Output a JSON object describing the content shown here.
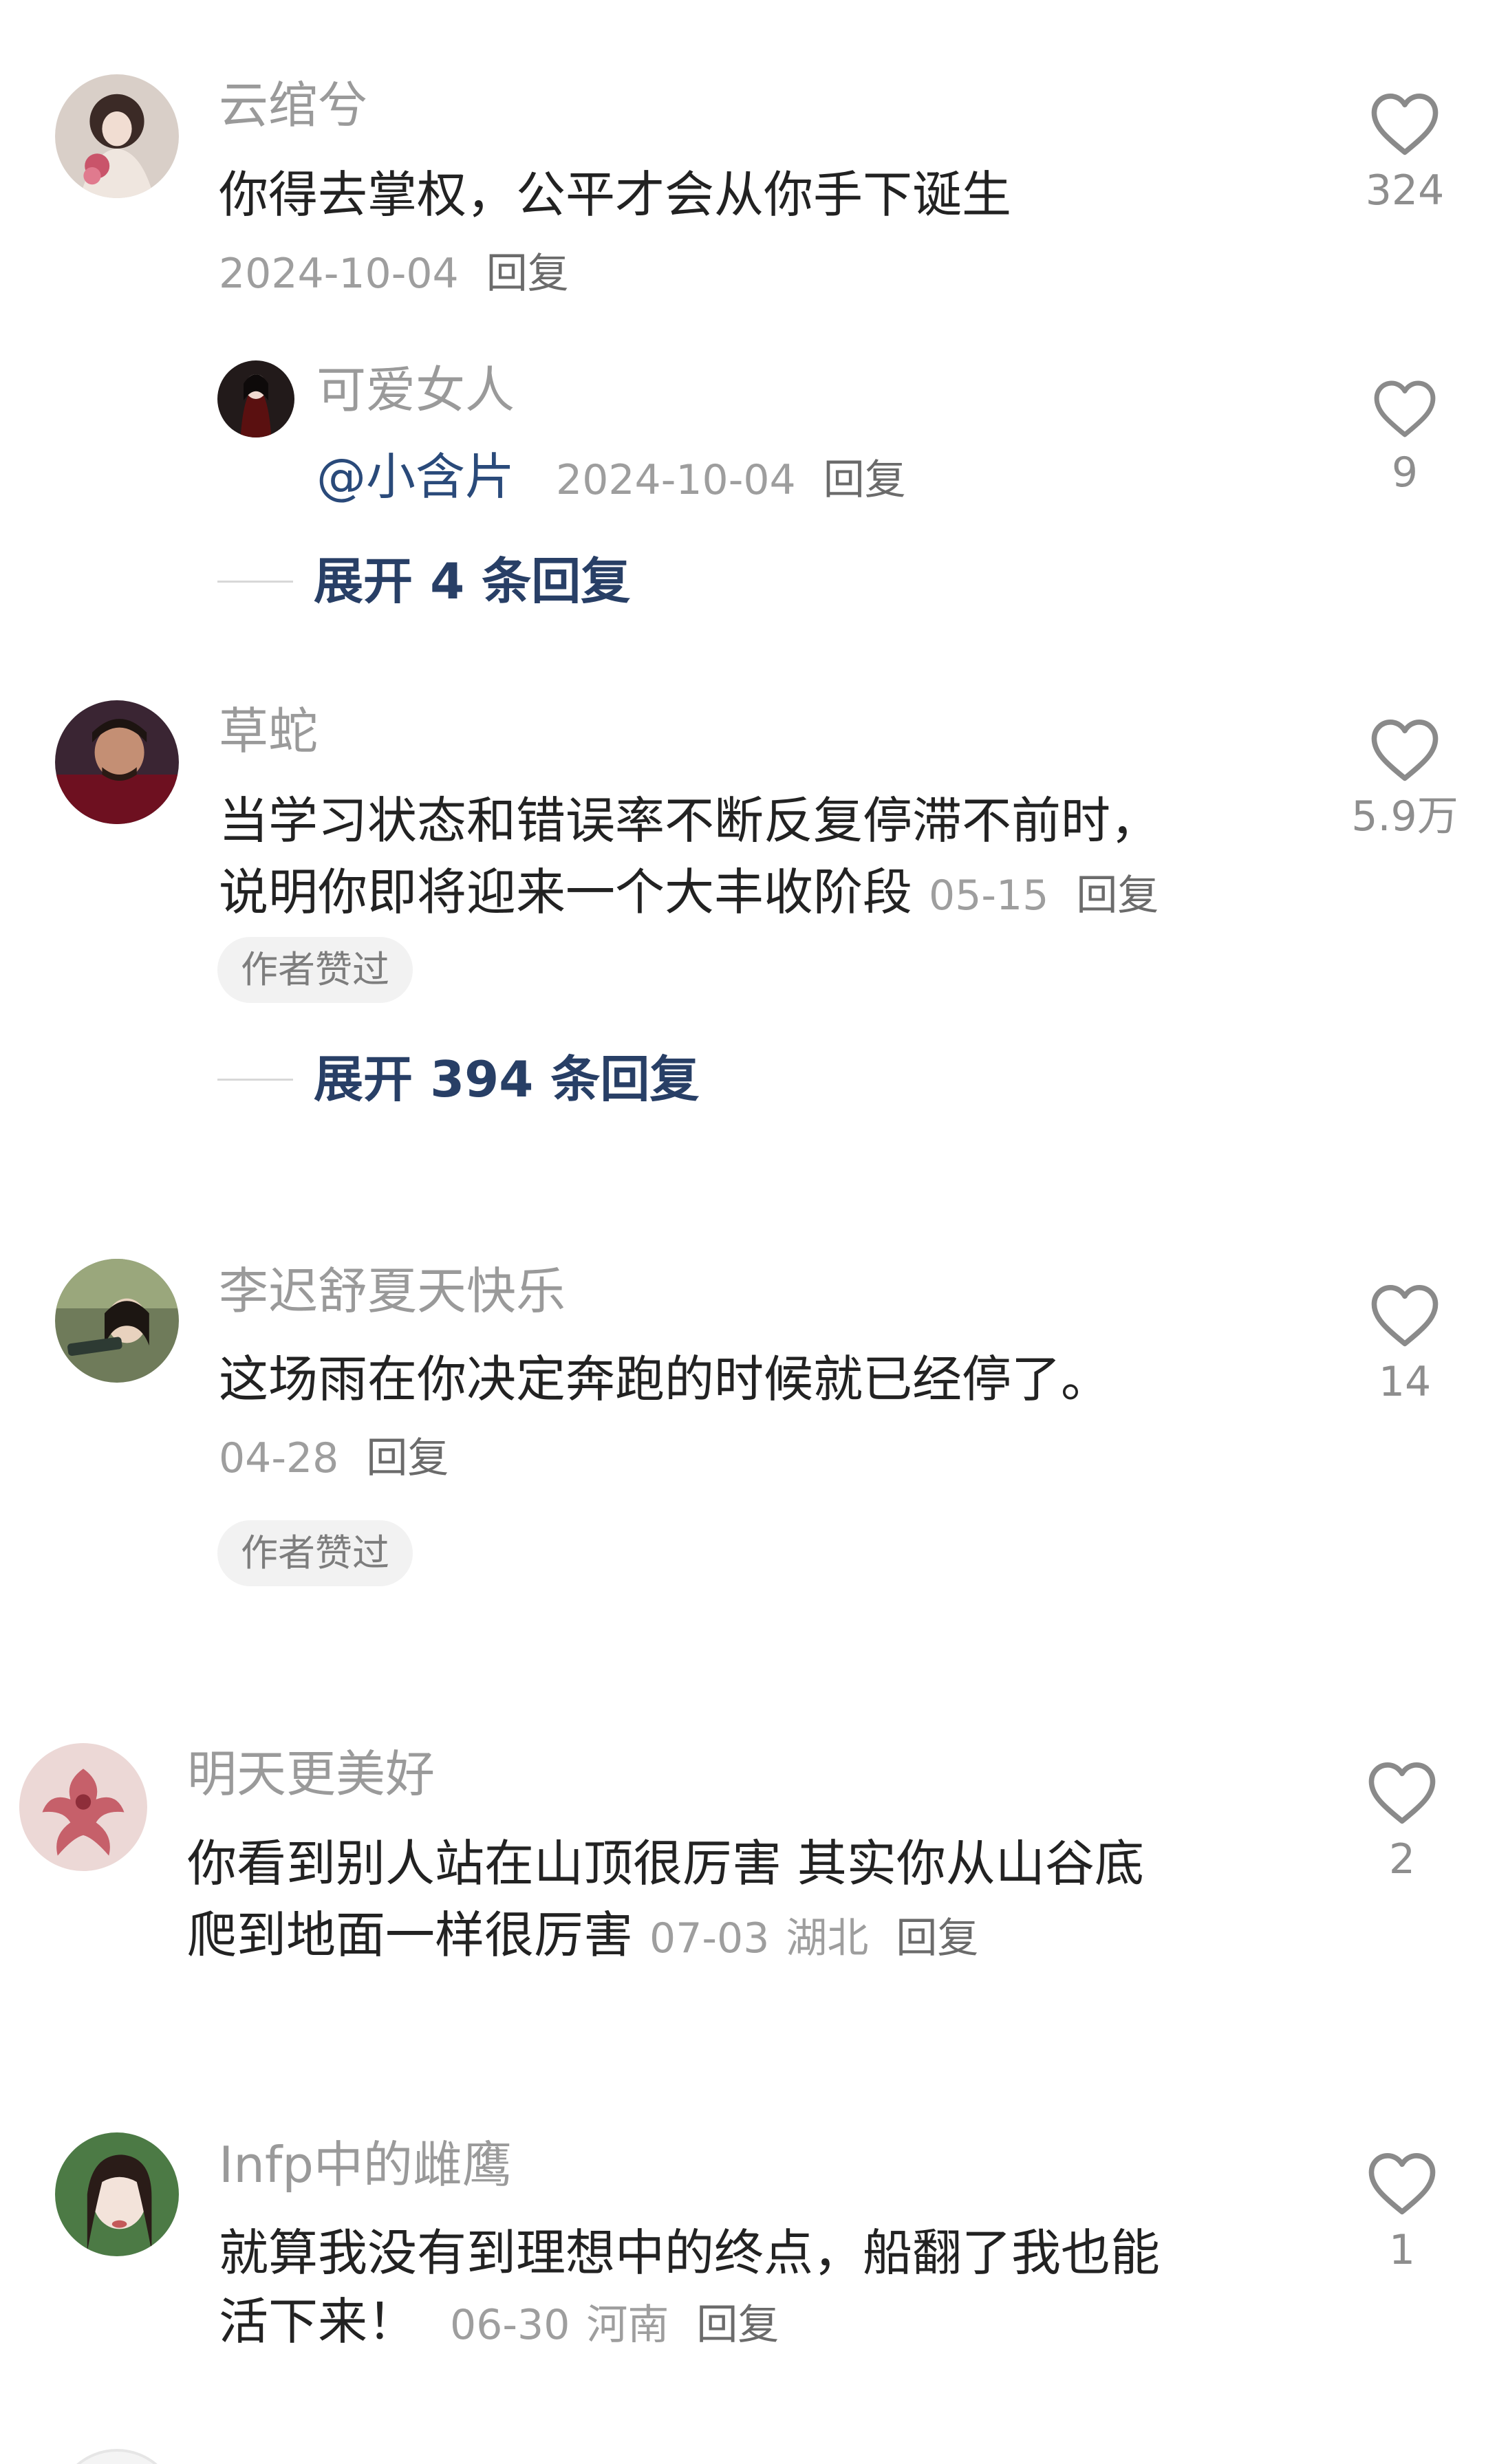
{
  "comments": [
    {
      "username": "云绾兮",
      "text": "你得去掌权，公平才会从你手下诞生",
      "date": "2024-10-04",
      "reply_label": "回复",
      "like_count": "324",
      "replies": [
        {
          "username": "可爱女人",
          "mention": "@小含片",
          "date": "2024-10-04",
          "reply_label": "回复",
          "like_count": "9"
        }
      ],
      "expand_label": "展开 4 条回复"
    },
    {
      "username": "草蛇",
      "text_line1": "当学习状态和错误率不断反复停滞不前时，",
      "text_line2": "说明你即将迎来一个大丰收阶段",
      "date": "05-15",
      "reply_label": "回复",
      "like_count": "5.9万",
      "badge": "作者赞过",
      "expand_label": "展开 394 条回复"
    },
    {
      "username": "李迟舒夏天快乐",
      "text": "这场雨在你决定奔跑的时候就已经停了。",
      "date": "04-28",
      "reply_label": "回复",
      "like_count": "14",
      "badge": "作者赞过"
    },
    {
      "username": "明天更美好",
      "text_line1": "你看到别人站在山顶很厉害 其实你从山谷底",
      "text_line2": "爬到地面一样很厉害",
      "date": "07-03",
      "location": "湖北",
      "reply_label": "回复",
      "like_count": "2"
    },
    {
      "username": "Infp中的雌鹰",
      "text_line1": "就算我没有到理想中的终点，船翻了我也能",
      "text_line2": "活下来！",
      "date": "06-30",
      "location": "河南",
      "reply_label": "回复",
      "like_count": "1"
    }
  ],
  "icons": {
    "like": "heart-outline-icon"
  },
  "colors": {
    "username": "#9a9a9a",
    "body": "#222222",
    "meta": "#9e9e9e",
    "expand": "#283f66",
    "badge_bg": "#f2f2f2"
  }
}
